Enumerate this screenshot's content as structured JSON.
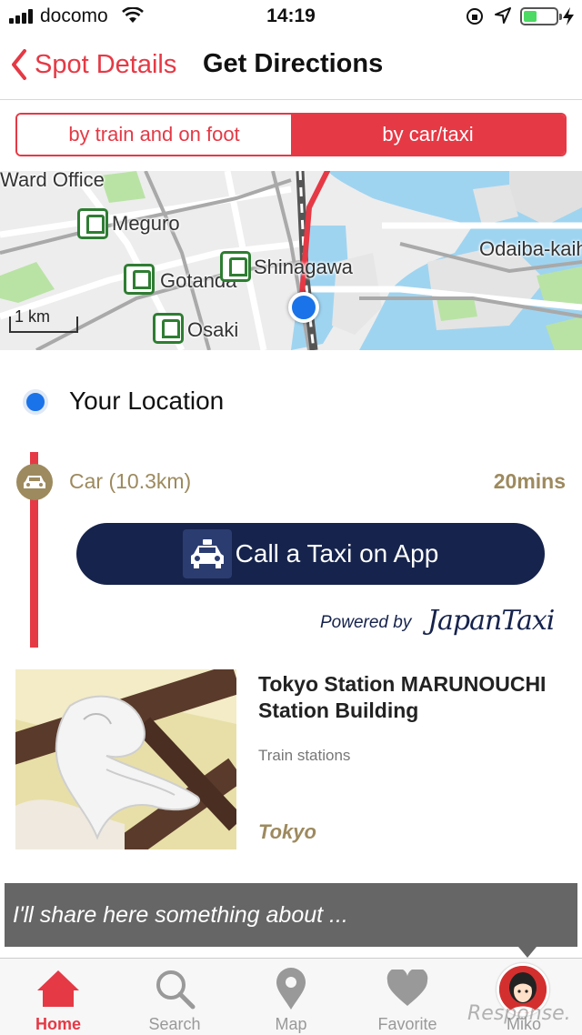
{
  "status_bar": {
    "carrier": "docomo",
    "time": "14:19",
    "battery_color": "#4cd964"
  },
  "nav": {
    "back_label": "Spot Details",
    "title": "Get Directions"
  },
  "segment": {
    "options": [
      "by train and on foot",
      "by car/taxi"
    ],
    "selected": "by car/taxi",
    "accent": "#e53945"
  },
  "map": {
    "labels": {
      "ward_office": "Ward Office",
      "meguro": "Meguro",
      "gotanda": "Gotanda",
      "osaki": "Osaki",
      "shinagawa": "Shinagawa",
      "odaiba": "Odaiba-kaih"
    },
    "scale": "1 km"
  },
  "route": {
    "origin": "Your Location",
    "mode": "Car (10.3km)",
    "duration": "20mins",
    "taxi_button": "Call a Taxi on App",
    "powered_by": "Powered by",
    "provider": "JapanTaxi"
  },
  "spot": {
    "title": "Tokyo Station MARUNOUCHI Station Building",
    "category": "Train stations",
    "city": "Tokyo"
  },
  "banner": {
    "text": "I'll share here something about ..."
  },
  "tabs": [
    {
      "label": "Home",
      "icon": "home-icon"
    },
    {
      "label": "Search",
      "icon": "search-icon"
    },
    {
      "label": "Map",
      "icon": "map-pin-icon"
    },
    {
      "label": "Favorite",
      "icon": "heart-icon"
    },
    {
      "label": "Miko",
      "icon": "avatar-icon"
    }
  ],
  "watermark": "Response."
}
